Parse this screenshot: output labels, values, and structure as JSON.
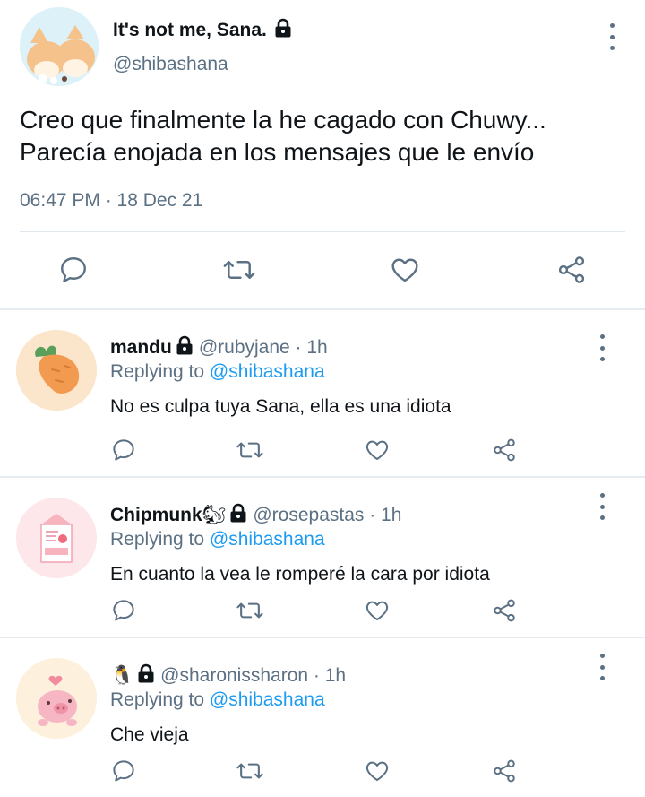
{
  "main_tweet": {
    "name": "It's not me, Sana.",
    "handle": "@shibashana",
    "text_line1": "Creo que finalmente la he cagado con Chuwy...",
    "text_line2": "Parecía enojada en los mensajes que le envío",
    "timestamp": "06:47 PM · 18 Dec 21"
  },
  "replies": [
    {
      "name": "mandu",
      "emoji": "",
      "handle_time": "@rubyjane · 1h",
      "replying_prefix": "Replying to",
      "replying_to": "@shibashana",
      "text": "No es culpa tuya Sana, ella es una idiota"
    },
    {
      "name": "Chipmunk",
      "emoji": "🐿",
      "handle_time": "@rosepastas · 1h",
      "replying_prefix": "Replying to",
      "replying_to": "@shibashana",
      "text": "En cuanto la vea le romperé la cara por idiota"
    },
    {
      "name": "",
      "emoji": "🐧",
      "handle_time": "@sharonissharon · 1h",
      "replying_prefix": "Replying to",
      "replying_to": "@shibashana",
      "text": "Che vieja"
    }
  ],
  "colors": {
    "text": "#0f1419",
    "muted": "#5b7083",
    "link": "#1d9bf0",
    "divider": "#e6ecf0"
  },
  "icons": [
    "lock-icon",
    "more-icon",
    "reply-icon",
    "retweet-icon",
    "like-icon",
    "share-icon"
  ]
}
